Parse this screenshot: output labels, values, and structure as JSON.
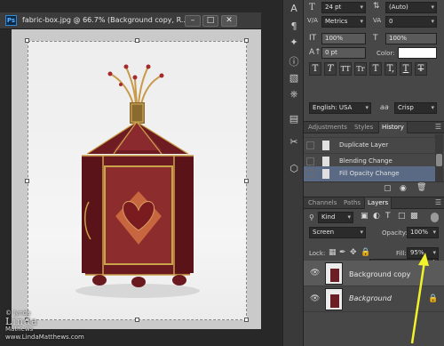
{
  "document": {
    "ps_badge": "Ps",
    "title": "fabric-box.jpg @ 66.7% (Background copy, R...",
    "minimize_glyph": "–",
    "maximize_glyph": "□",
    "close_glyph": "✕"
  },
  "watermark": {
    "line1": "© lynda",
    "line2": "Linda",
    "line3": "Mathews",
    "line4": "www.LindaMatthews.com"
  },
  "character_panel": {
    "font_size": "24 pt",
    "leading": "(Auto)",
    "kerning": "Metrics",
    "tracking": "0",
    "vertical_scale": "100%",
    "horizontal_scale": "100%",
    "baseline_shift": "0 pt",
    "color_label": "Color:",
    "type_buttons": [
      "T",
      "T",
      "TT",
      "Tr",
      "T",
      "T,",
      "T",
      "T"
    ],
    "language": "English: USA",
    "anti_alias_icon": "aa",
    "anti_alias": "Crisp"
  },
  "history_panel": {
    "tabs": [
      "Adjustments",
      "Styles",
      "History"
    ],
    "active_tab": "History",
    "items": [
      "Duplicate Layer",
      "Blending Change",
      "Fill Opacity Change"
    ],
    "selected_item": "Fill Opacity Change"
  },
  "layers_panel": {
    "tabs": [
      "Channels",
      "Paths",
      "Layers"
    ],
    "active_tab": "Layers",
    "filter_kind": "Kind",
    "blend_mode": "Screen",
    "opacity_label": "Opacity:",
    "opacity": "100%",
    "lock_label": "Lock:",
    "fill_label": "Fill:",
    "fill": "95%",
    "fill_level": 0.95,
    "layers": [
      {
        "name": "Background copy",
        "selected": true
      },
      {
        "name": "Background",
        "selected": false
      }
    ]
  },
  "colors": {
    "panel_bg": "#474747",
    "selection": "#5a6a85",
    "arrow": "#f2f22a",
    "box_red": "#7a1d24"
  }
}
